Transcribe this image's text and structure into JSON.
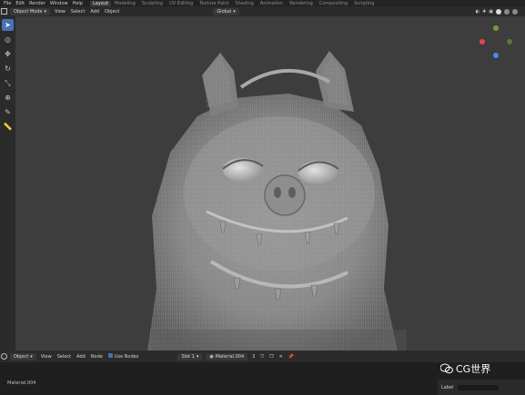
{
  "topbar": {
    "menu": [
      "File",
      "Edit",
      "Render",
      "Window",
      "Help"
    ],
    "workspaces": [
      "Layout",
      "Modeling",
      "Sculpting",
      "UV Editing",
      "Texture Paint",
      "Shading",
      "Animation",
      "Rendering",
      "Compositing",
      "Scripting"
    ]
  },
  "viewport_header": {
    "mode": "Object Mode",
    "menus": [
      "View",
      "Select",
      "Add",
      "Object"
    ],
    "orientation": "Global"
  },
  "node_header": {
    "type": "Object",
    "menus": [
      "View",
      "Select",
      "Add",
      "Node"
    ],
    "use_nodes": "Use Nodes",
    "slot": "Slot 1",
    "material": "Material.004",
    "users": "3"
  },
  "node_editor": {
    "material_label": "Material.004"
  },
  "side_panel": {
    "label_text": "Label"
  },
  "watermark": {
    "text": "CG世界"
  },
  "colors": {
    "accent": "#4772b3",
    "viewport_bg": "#3d3d3d",
    "axis_x": "#e8434f",
    "axis_y": "#6ea230",
    "axis_z": "#3f8ff0"
  }
}
